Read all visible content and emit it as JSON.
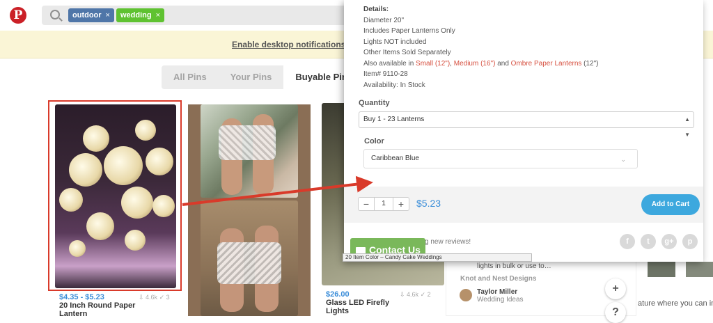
{
  "search": {
    "chips": [
      {
        "label": "outdoor",
        "close": "×"
      },
      {
        "label": "wedding",
        "close": "×"
      }
    ]
  },
  "notification": {
    "text": "Enable desktop notifications to"
  },
  "tabs": [
    {
      "label": "All Pins",
      "active": false
    },
    {
      "label": "Your Pins",
      "active": false
    },
    {
      "label": "Buyable Pins",
      "active": true
    }
  ],
  "pins": [
    {
      "price": "$4.35 - $5.23",
      "saves": "4.6k",
      "likes": "3",
      "title_line1": "20 Inch Round Paper",
      "title_line2": "Lantern"
    },
    {
      "price": "$26.00",
      "saves": "4.6k",
      "likes": "2",
      "title_line1": "Glass LED Firefly",
      "title_line2": "Lights"
    }
  ],
  "product": {
    "details_heading": "Details:",
    "details_lines": [
      "Diameter 20\"",
      "Includes Paper Lanterns Only",
      "Lights NOT included",
      "Other Items Sold Separately"
    ],
    "also_prefix": "Also available in ",
    "also_small": "Small (12\")",
    "also_sep": ", ",
    "also_medium": "Medium (16\")",
    "also_and": " and ",
    "also_ombre": "Ombre Paper Lanterns",
    "also_suffix": " (12\")",
    "item_no": "Item# 9110-28",
    "availability": "Availability: In Stock",
    "quantity_label": "Quantity",
    "quantity_value": "Buy 1 - 23 Lanterns",
    "color_label": "Color",
    "color_value": "Caribbean Blue",
    "qty": "1",
    "minus": "−",
    "plus": "+",
    "price": "$5.23",
    "add_to_cart": "Add to Cart",
    "reviews_text": "g new reviews!"
  },
  "social": [
    "f",
    "t",
    "g+",
    "p"
  ],
  "contact_button": "Contact Us",
  "caption": "20  Item Color – Candy Cake Weddings",
  "background_pin": {
    "desc": "lights in bulk or use to…",
    "source": "Knot and Nest Designs",
    "user_name": "Taylor Miller",
    "user_board": "Wedding Ideas"
  },
  "side_text": "ature where you can inte",
  "round_buttons": {
    "plus": "+",
    "help": "?"
  },
  "colors": {
    "pinterest_red": "#cb2027",
    "link_blue": "#3a8dd9",
    "accent_red": "#d64f3f",
    "contact_green": "#7ab85a",
    "cart_blue": "#3da8de",
    "arrow_red": "#d93a2a"
  }
}
